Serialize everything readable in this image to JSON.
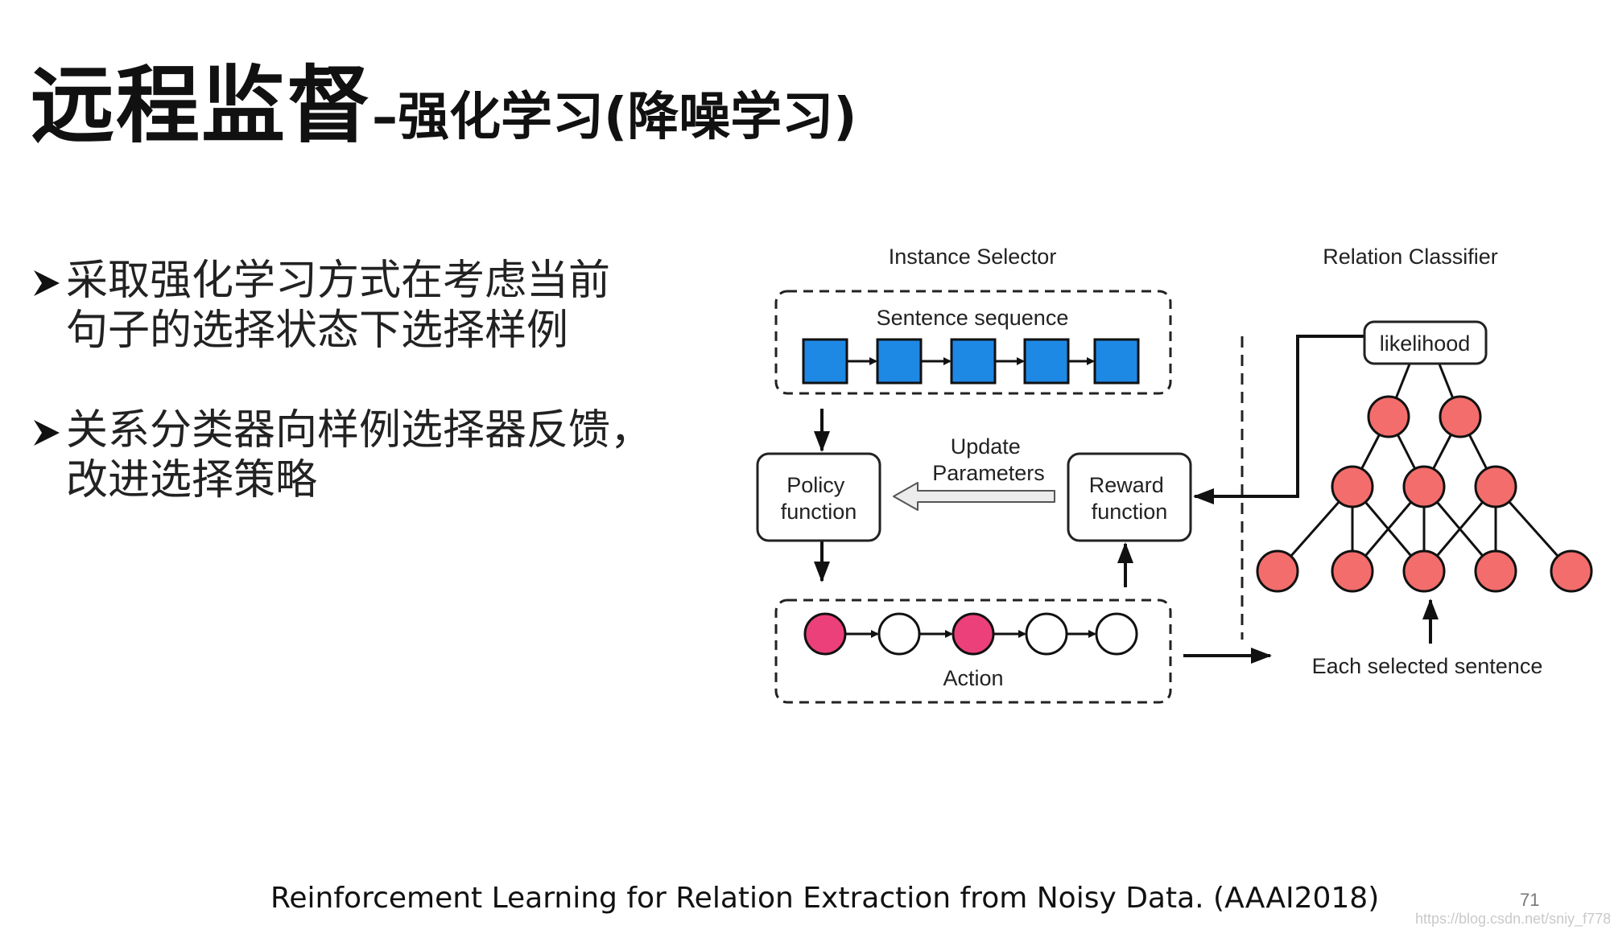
{
  "slide": {
    "title_main": "远程监督",
    "title_sub": "–强化学习(降噪学习)",
    "bullets": [
      {
        "lines": [
          "采取强化学习方式在考虑当前",
          "句子的选择状态下选择样例"
        ]
      },
      {
        "lines": [
          "关系分类器向样例选择器反馈，",
          "改进选择策略"
        ]
      }
    ],
    "footer": "Reinforcement Learning for Relation Extraction from Noisy Data. (AAAI2018)",
    "page_number": "71",
    "watermark": "https://blog.csdn.net/sniy_f778"
  },
  "diagram": {
    "instance_selector_label": "Instance Selector",
    "relation_classifier_label": "Relation Classifier",
    "sentence_sequence_label": "Sentence sequence",
    "policy_label": [
      "Policy",
      "function"
    ],
    "reward_label": [
      "Reward",
      "function"
    ],
    "update_label": [
      "Update",
      "Parameters"
    ],
    "action_label": "Action",
    "likelihood_label": "likelihood",
    "each_selected_label": "Each selected sentence",
    "action_states": [
      "selected",
      "empty",
      "selected",
      "empty",
      "empty"
    ],
    "colors": {
      "square": "#1e88e5",
      "selected": "#ec407a",
      "node": "#f26d6b"
    }
  }
}
